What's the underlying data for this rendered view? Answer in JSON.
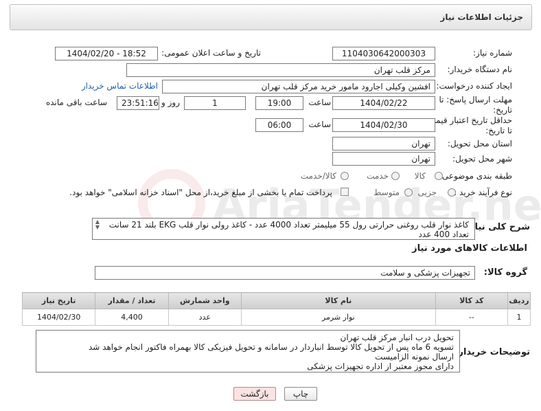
{
  "header": {
    "title": "جزئیات اطلاعات نیاز"
  },
  "form": {
    "need_number": {
      "label": "شماره نیاز:",
      "value": "1104030642000303"
    },
    "announce_datetime": {
      "label": "تاریخ و ساعت اعلان عمومی:",
      "value": "1404/02/20 - 18:52"
    },
    "buyer_org": {
      "label": "نام دستگاه خریدار:",
      "value": "مرکز قلب تهران"
    },
    "requester": {
      "label": "ایجاد کننده درخواست:",
      "value": "افشین وکیلی اجارود مامور خرید مرکز قلب تهران",
      "contact_link": "اطلاعات تماس خریدار"
    },
    "reply_deadline": {
      "label_line1": "مهلت ارسال پاسخ: تا",
      "label_line2": "تاریخ:",
      "date": "1404/02/22",
      "time_label": "ساعت",
      "time": "19:00",
      "days": "1",
      "days_label": "روز و",
      "remaining": "23:51:16",
      "remaining_label": "ساعت باقی مانده"
    },
    "price_validity": {
      "label_line1": "حداقل تاریخ اعتبار قیمت:",
      "label_line2": "تا تاریخ:",
      "date": "1404/02/30",
      "time_label": "ساعت",
      "time": "06:00"
    },
    "province": {
      "label": "استان محل تحویل:",
      "value": "تهران"
    },
    "city": {
      "label": "شهر محل تحویل:",
      "value": "تهران"
    },
    "category": {
      "label": "طبقه بندی موضوعی:",
      "options": [
        "کالا",
        "خدمت",
        "کالا/خدمت"
      ]
    },
    "purchase_type": {
      "label": "نوع فرآیند خرید :",
      "options": [
        "جزیی",
        "متوسط"
      ],
      "note": "پرداخت تمام یا بخشی از مبلغ خرید،از محل \"اسناد خزانه اسلامی\" خواهد بود."
    }
  },
  "description": {
    "label": "شرح کلی نیاز:",
    "text": "کاغذ نوار قلب روغنی حرارتی رول 55 میلیمتر تعداد 4000 عدد - کاغذ رولی نوار قلب EKG بلند 21 سانت تعداد 400 عدد"
  },
  "goods_info": {
    "title": "اطلاعات کالاهای مورد نیاز"
  },
  "goods_group": {
    "label": "گروه کالا:",
    "value": "تجهیزات پزشکی و سلامت"
  },
  "table": {
    "headers": [
      "ردیف",
      "کد کالا",
      "نام کالا",
      "واحد شمارش",
      "تعداد / مقدار",
      "تاریخ نیاز"
    ],
    "rows": [
      [
        "1",
        "--",
        "نوار شرمر",
        "عدد",
        "4,400",
        "1404/02/30"
      ]
    ]
  },
  "buyer_notes": {
    "label": "توضیحات خریدار:",
    "lines": [
      "تحویل درب انبار مرکز قلب تهران",
      "تسویه 6 ماه پس از تحویل کالا توسط انباردار در سامانه و تحویل فیزیکی کالا بهمراه فاکتور انجام خواهد شد",
      "ارسال نمونه الزامیست",
      "دارای مجوز معتبر از اداره تجهیزات پزشکی"
    ]
  },
  "buttons": {
    "print": "چاپ",
    "back": "بازگشت"
  },
  "watermark": {
    "text": "AriaTender.neT"
  }
}
